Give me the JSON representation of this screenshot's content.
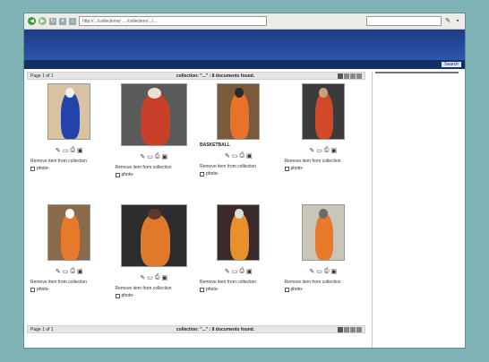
{
  "browser": {
    "address": "http://.../collections/ ... /collection/.../...",
    "search_placeholder": "",
    "back": "◀",
    "forward": "▶"
  },
  "site_nav": {
    "items": [
      "",
      "",
      "",
      ""
    ],
    "user_text": "",
    "search_label": "Search"
  },
  "pager": {
    "page_label": "Page 1 of 1",
    "result_text": "collection: \"...\" : 8 documents found.",
    "bottom_result_text": "collection: \"...\" : 8 documents found."
  },
  "cards": [
    {
      "caption": "",
      "remove": "Remove item from collection",
      "id": "photo-"
    },
    {
      "caption": "",
      "remove": "Remove item from collection",
      "id": "photo-"
    },
    {
      "caption": "BASKETBALL",
      "remove": "Remove item from collection",
      "id": "photo-"
    },
    {
      "caption": "",
      "remove": "Remove item from collection",
      "id": "photo-"
    },
    {
      "caption": "",
      "remove": "Remove item from collection",
      "id": "photo-"
    },
    {
      "caption": "",
      "remove": "Remove item from collection",
      "id": "photo-"
    },
    {
      "caption": "",
      "remove": "Remove item from collection",
      "id": "photo-"
    },
    {
      "caption": "",
      "remove": "Remove item from collection",
      "id": "photo-"
    }
  ],
  "sidebar": {
    "header": "",
    "group1": [
      "",
      "",
      "",
      "",
      ""
    ],
    "group1_highlight": "",
    "section2_title": "",
    "group2": [
      "",
      ""
    ],
    "section3_title": "",
    "group3": [
      "",
      "",
      "",
      "",
      "",
      "",
      "",
      "",
      "",
      "",
      "",
      "",
      "",
      "",
      "",
      "",
      "",
      "",
      "",
      "",
      "",
      "",
      "",
      "",
      "",
      "",
      "",
      "",
      "",
      "",
      "",
      "",
      ""
    ],
    "section4_title": "",
    "group4": [
      ""
    ]
  },
  "colors": {
    "background": "#7fb3b5",
    "header_blue": "#2c56ad",
    "accent_orange": "#e85b2a"
  }
}
